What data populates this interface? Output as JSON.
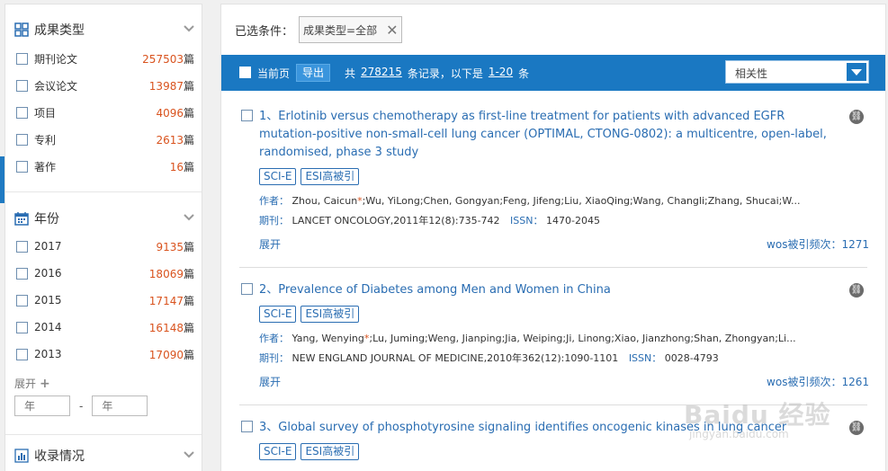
{
  "sidebar": {
    "type_facet": {
      "title": "成果类型",
      "items": [
        {
          "label": "期刊论文",
          "count": "257503",
          "unit": "篇"
        },
        {
          "label": "会议论文",
          "count": "13987",
          "unit": "篇"
        },
        {
          "label": "项目",
          "count": "4096",
          "unit": "篇"
        },
        {
          "label": "专利",
          "count": "2613",
          "unit": "篇"
        },
        {
          "label": "著作",
          "count": "16",
          "unit": "篇"
        }
      ]
    },
    "year_facet": {
      "title": "年份",
      "items": [
        {
          "label": "2017",
          "count": "9135",
          "unit": "篇"
        },
        {
          "label": "2016",
          "count": "18069",
          "unit": "篇"
        },
        {
          "label": "2015",
          "count": "17147",
          "unit": "篇"
        },
        {
          "label": "2014",
          "count": "16148",
          "unit": "篇"
        },
        {
          "label": "2013",
          "count": "17090",
          "unit": "篇"
        }
      ],
      "expand_label": "展开",
      "from_placeholder": "年",
      "dash": "-",
      "to_placeholder": "年"
    },
    "collection_facet": {
      "title": "收录情况"
    }
  },
  "main": {
    "filter_label": "已选条件：",
    "filter_tag": "成果类型=全部",
    "toolbar": {
      "current_page": "当前页",
      "export": "导出",
      "summary_prefix": "共",
      "total": "278215",
      "summary_mid": "条记录，以下是",
      "range": "1-20",
      "summary_suffix": "条",
      "sort_value": "相关性"
    },
    "results": [
      {
        "title": "1、Erlotinib versus chemotherapy as first-line treatment for patients with advanced EGFR mutation-positive non-small-cell lung cancer (OPTIMAL, CTONG-0802): a multicentre, open-label, randomised, phase 3 study",
        "badges": [
          "SCI-E",
          "ESI高被引"
        ],
        "author_key": "作者：",
        "authors_first": "Zhou, Caicun",
        "authors_rest": ";Wu, YiLong;Chen, Gongyan;Feng, Jifeng;Liu, XiaoQing;Wang, Changli;Zhang, Shucai;W...",
        "journal_key": "期刊：",
        "journal": "LANCET ONCOLOGY,2011年12(8):735-742",
        "issn_key": "ISSN：",
        "issn": "1470-2045",
        "expand": "展开",
        "cite_label": "wos被引频次：",
        "cite": "1271"
      },
      {
        "title": "2、Prevalence of Diabetes among Men and Women in China",
        "badges": [
          "SCI-E",
          "ESI高被引"
        ],
        "author_key": "作者：",
        "authors_first": "Yang, Wenying",
        "authors_rest": ";Lu, Juming;Weng, Jianping;Jia, Weiping;Ji, Linong;Xiao, Jianzhong;Shan, Zhongyan;Li...",
        "journal_key": "期刊：",
        "journal": "NEW ENGLAND JOURNAL OF MEDICINE,2010年362(12):1090-1101",
        "issn_key": "ISSN：",
        "issn": "0028-4793",
        "expand": "展开",
        "cite_label": "wos被引频次：",
        "cite": "1261"
      },
      {
        "title": "3、Global survey of phosphotyrosine signaling identifies oncogenic kinases in lung cancer",
        "badges": [
          "SCI-E",
          "ESI高被引"
        ]
      }
    ]
  },
  "watermark": {
    "logo": "Baidu 经验",
    "url": "jingyan.baidu.com"
  }
}
